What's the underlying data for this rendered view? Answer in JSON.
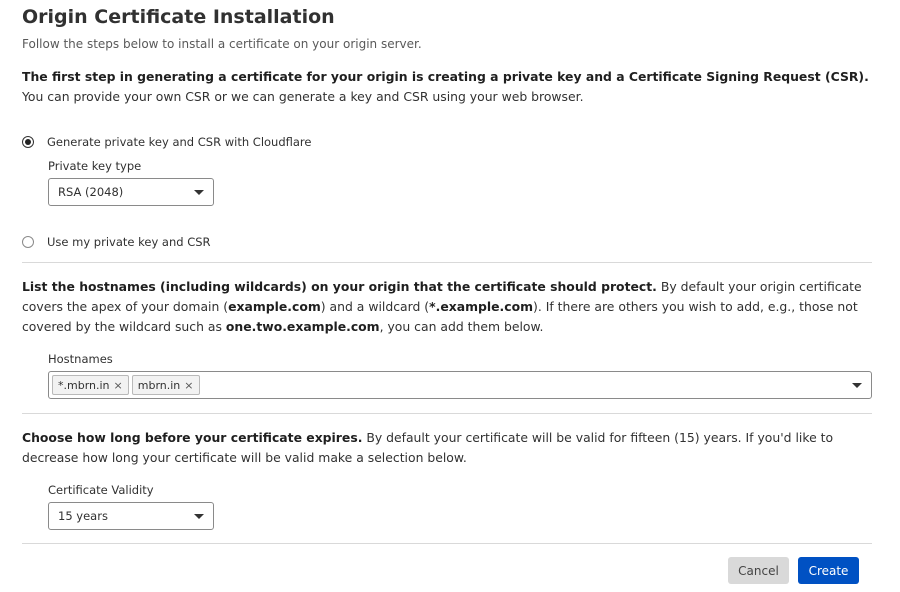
{
  "header": {
    "title": "Origin Certificate Installation",
    "subtitle": "Follow the steps below to install a certificate on your origin server."
  },
  "step1": {
    "bold": "The first step in generating a certificate for your origin is creating a private key and a Certificate Signing Request (CSR).",
    "text": " You can provide your own CSR or we can generate a key and CSR using your web browser.",
    "option_generate": "Generate private key and CSR with Cloudflare",
    "option_generate_selected": true,
    "key_type_label": "Private key type",
    "key_type_value": "RSA (2048)",
    "option_own": "Use my private key and CSR",
    "option_own_selected": false
  },
  "step2": {
    "bold": "List the hostnames (including wildcards) on your origin that the certificate should protect.",
    "text_a": " By default your origin certificate covers the apex of your domain (",
    "domain_apex": "example.com",
    "text_b": ") and a wildcard (",
    "domain_wildcard": "*.example.com",
    "text_c": "). If there are others you wish to add, e.g., those not covered by the wildcard such as ",
    "domain_example": "one.two.example.com",
    "text_d": ", you can add them below.",
    "hostnames_label": "Hostnames",
    "hostnames": [
      "*.mbrn.in",
      "mbrn.in"
    ],
    "remove_glyph": "×"
  },
  "step3": {
    "bold": "Choose how long before your certificate expires.",
    "text": " By default your certificate will be valid for fifteen (15) years. If you'd like to decrease how long your certificate will be valid make a selection below.",
    "validity_label": "Certificate Validity",
    "validity_value": "15 years"
  },
  "actions": {
    "cancel_label": "Cancel",
    "create_label": "Create"
  },
  "colors": {
    "primary": "#0051c3",
    "secondary_button": "#d9d9d9",
    "text": "#313131",
    "divider": "#d9d9d9"
  }
}
